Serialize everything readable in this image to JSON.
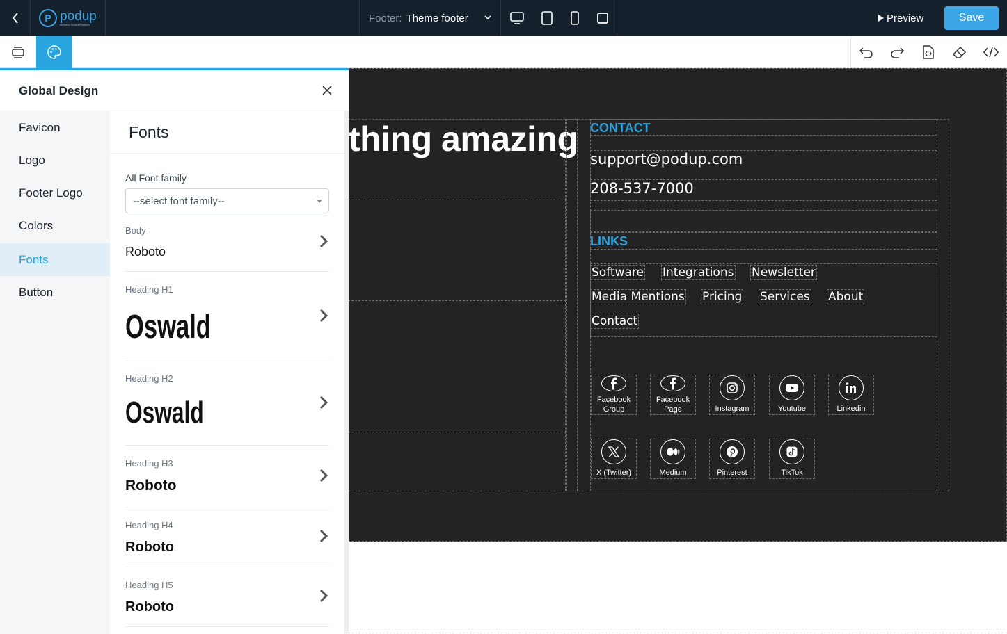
{
  "topbar": {
    "logo_word": "podup",
    "logo_sub": "formerly ShowItPlatform",
    "footer_label": "Footer:",
    "footer_value": "Theme footer",
    "preview_label": "Preview",
    "save_label": "Save"
  },
  "panel": {
    "title": "Global Design",
    "nav": [
      {
        "label": "Favicon"
      },
      {
        "label": "Logo"
      },
      {
        "label": "Footer Logo"
      },
      {
        "label": "Colors"
      },
      {
        "label": "Fonts"
      },
      {
        "label": "Button"
      }
    ],
    "active_nav": "Fonts",
    "content_title": "Fonts",
    "all_font_label": "All Font family",
    "all_font_placeholder": "--select font family--",
    "rows": [
      {
        "label": "Body",
        "value": "Roboto"
      },
      {
        "label": "Heading H1",
        "value": "Oswald"
      },
      {
        "label": "Heading H2",
        "value": "Oswald"
      },
      {
        "label": "Heading H3",
        "value": "Roboto"
      },
      {
        "label": "Heading H4",
        "value": "Roboto"
      },
      {
        "label": "Heading H5",
        "value": "Roboto"
      }
    ]
  },
  "footer": {
    "tagline": "thing amazing",
    "contact_title": "CONTACT",
    "email": "support@podup.com",
    "phone": "208-537-7000",
    "links_title": "LINKS",
    "links": [
      "Software",
      "Integrations",
      "Newsletter",
      "Media Mentions",
      "Pricing",
      "Services",
      "About",
      "Contact"
    ],
    "socials": [
      {
        "label": "Facebook Group",
        "icon": "facebook-icon"
      },
      {
        "label": "Facebook Page",
        "icon": "facebook-icon"
      },
      {
        "label": "Instagram",
        "icon": "instagram-icon"
      },
      {
        "label": "Youtube",
        "icon": "youtube-icon"
      },
      {
        "label": "Linkedin",
        "icon": "linkedin-icon"
      },
      {
        "label": "X (Twitter)",
        "icon": "x-icon"
      },
      {
        "label": "Medium",
        "icon": "medium-icon"
      },
      {
        "label": "Pinterest",
        "icon": "pinterest-icon"
      },
      {
        "label": "TikTok",
        "icon": "tiktok-icon"
      }
    ]
  },
  "colors": {
    "topbar_bg": "#14202c",
    "accent": "#29a6df",
    "footer_bg": "#232323"
  }
}
